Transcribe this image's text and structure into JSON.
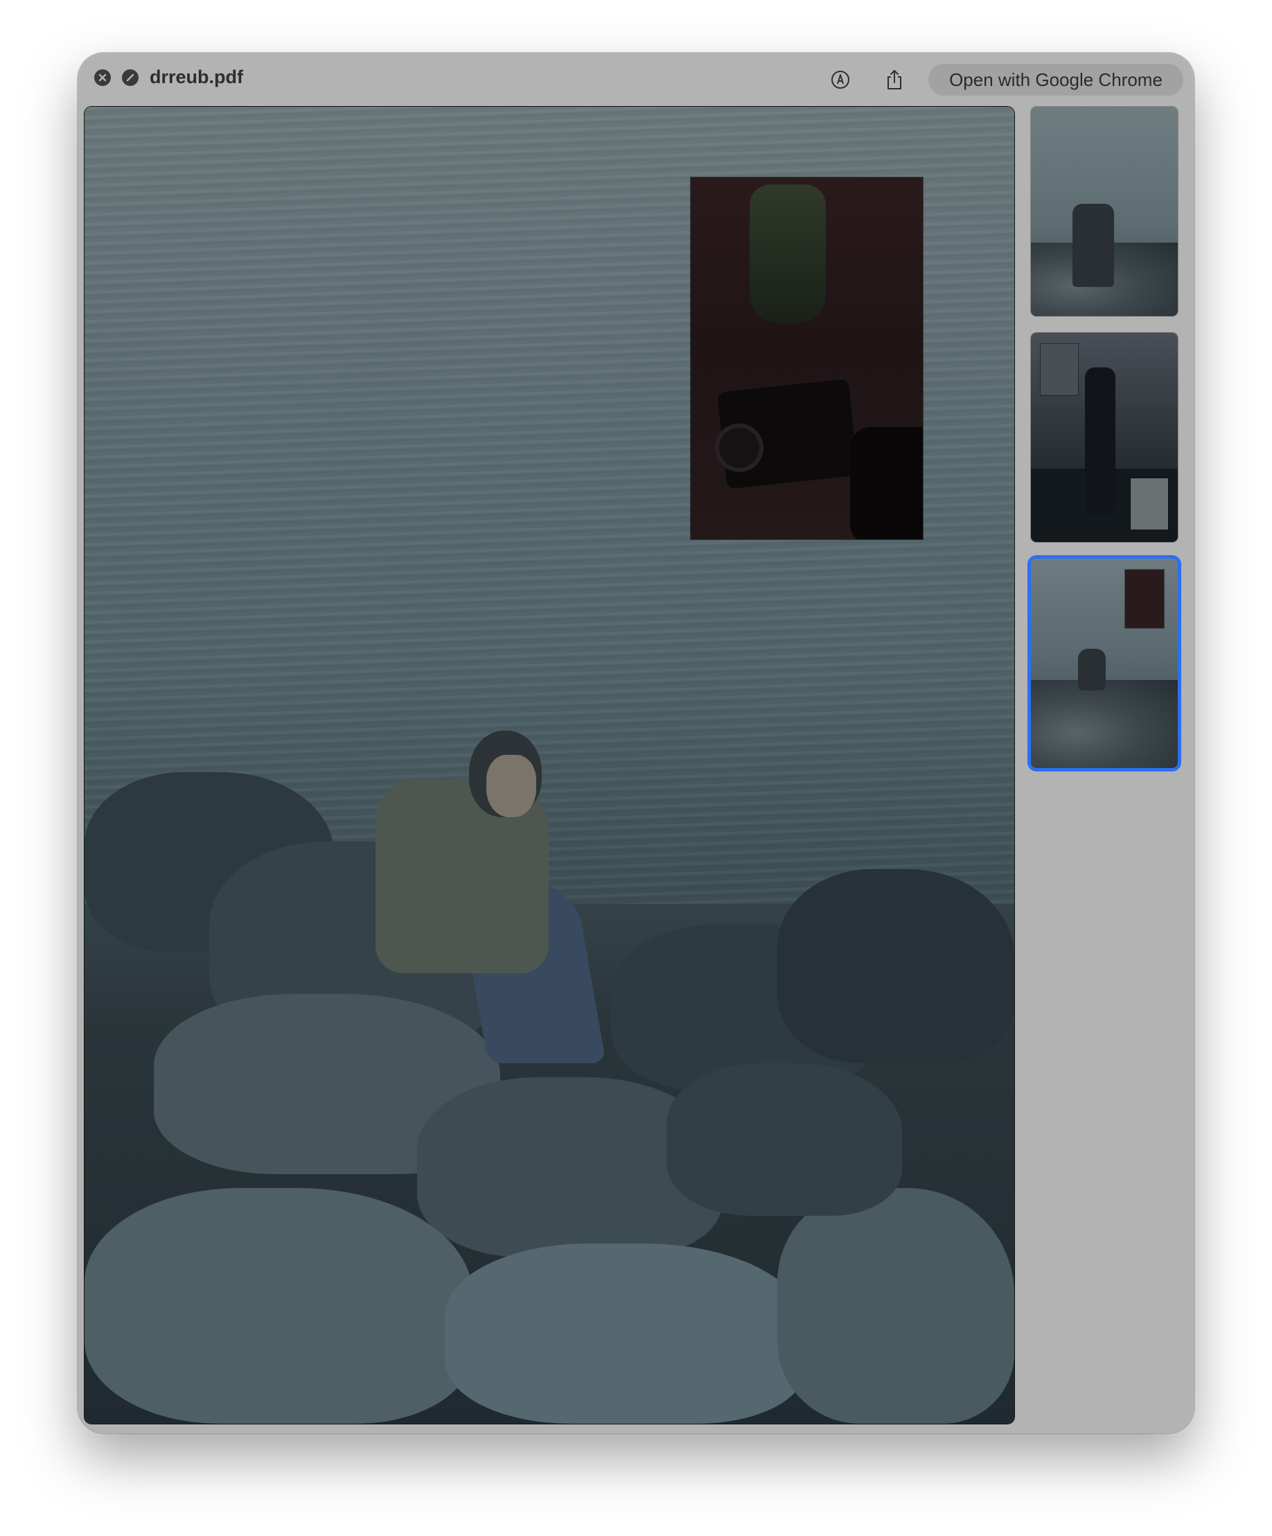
{
  "window": {
    "title": "drreub.pdf",
    "open_with_label": "Open with Google Chrome"
  },
  "toolbar": {
    "icons": [
      "close-icon",
      "blocked-icon",
      "markup-icon",
      "share-icon"
    ]
  },
  "thumbnails": {
    "count": 3,
    "selected_index": 2,
    "selected_color": "#2d6ff0"
  }
}
